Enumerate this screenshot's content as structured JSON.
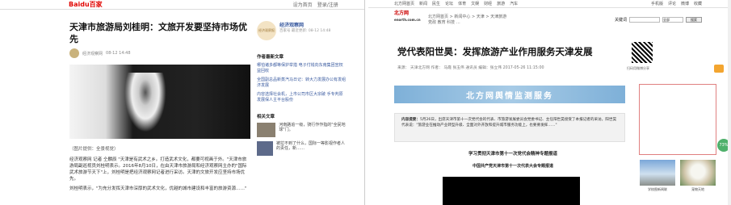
{
  "baidu": {
    "logo_main": "Bai",
    "logo_accent": "du",
    "logo_tail": "百家",
    "top_links": [
      "设为首页",
      "登录/注册"
    ],
    "title": "天津市旅游局刘桂明：文旅开发要坚持市场优先",
    "author": "经济观察网",
    "time": "08-12  14:48",
    "caption": "（图片提供：全景视觉）",
    "body": [
      "经济观察网 记者 仝麟辰 \"天津是有武术之乡。打造武术文化，都要可视画于外。\"天津市旅游局副巡视员刘桂明表示。2016年8月10日，在由天津市旅游局和经济观察网主办的\"国际武术旅游节天下\"上，刘桂明是把经济观察网记者进行采访。天津的文旅开发应坚持市场优先。",
      "刘桂明表示，\"为充分发挥天津市深厚的武术文化，优越的城市建设和丰富的旅游资源……\""
    ],
    "account": {
      "name": "经济观察网",
      "sub": "百家号  最近更新: 08-12  14:48",
      "logo_text": "经济观察报"
    },
    "more_title": "作者最新文章",
    "more_items": [
      "哪怕诸多都等保护举措 电子付钱向东南集团宣权益回收",
      "全国副总品新蒸汽马日记：转大力发展办公有发组济发展",
      "内容选择社会机，上市公司市区大宗破 手专判原发展保人主平台股份"
    ],
    "related_title": "相关文章",
    "related": [
      {
        "text": "河南路追一级，骑行作作指的\"全民地球\"门。"
      },
      {
        "text": "被拉不到了什么，国际一等影视作者人的责任，新……"
      }
    ]
  },
  "enorth": {
    "top_links": [
      "北方网首页",
      "新闻",
      "民生",
      "论坛",
      "体育",
      "文娱",
      "财经",
      "旅游",
      "汽车"
    ],
    "top_right": [
      "手机版",
      "评论",
      "微博",
      "收藏"
    ],
    "logo": "北方网",
    "logo_sub": "enorth.com.cn",
    "crumb": "北方网首页 > 新闻中心 > 天津 > 天津旅游",
    "crumb_sub": "党政 教育 科技 …",
    "search_label": "关键词",
    "search_scope": "全部",
    "search_button": "搜索",
    "title": "党代表阳世昊：发挥旅游产业作用服务天津发展",
    "meta": "来源：  天津北方网    作者：  马霞 张玉伟 通讯员    编辑：张立伟    2017-05-26  11:15:00",
    "qr_caption": "扫码用微博分享",
    "banner": "北方网舆情监测服务",
    "summary_label": "内容提要：",
    "summary": "5月26日，出席天津市第十一次党代会的代表、市旅游发展委员会党委书记、主任阳世昊接受了本报记者的采访。阳世昊代表说：\"旅游业在推动产业转型升级、全面对外开放和提升城市服务功能上，也要要发挥……\"",
    "sub1": "学习贯彻天津市第十一次党代会精神专题报道",
    "sub2": "中国共产党天津市第十一次代表大会专题报道",
    "badge": "73%",
    "thumbs": [
      {
        "caption": "学校图新闻联"
      },
      {
        "caption": "宠物天地"
      }
    ]
  }
}
